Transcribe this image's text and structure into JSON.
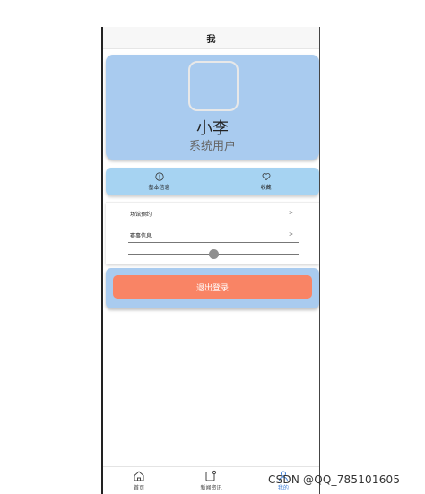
{
  "header": {
    "title": "我"
  },
  "profile": {
    "name": "小李",
    "role": "系统用户"
  },
  "shortcuts": [
    {
      "label": "基本信息",
      "icon": "info-icon"
    },
    {
      "label": "收藏",
      "icon": "heart-icon"
    }
  ],
  "list": [
    {
      "label": "场馆预约",
      "arrow": ">"
    },
    {
      "label": "赛事信息",
      "arrow": ">"
    }
  ],
  "slider": {
    "value": 0.5
  },
  "logout": {
    "label": "退出登录"
  },
  "tabbar": [
    {
      "label": "首页",
      "icon": "home-icon",
      "active": false
    },
    {
      "label": "新闻资讯",
      "icon": "news-icon",
      "active": false
    },
    {
      "label": "我的",
      "icon": "user-icon",
      "active": true
    }
  ],
  "watermark": "CSDN @QQ_785101605",
  "colors": {
    "card": "#a9cbef",
    "shortcut_bar": "#a6d3f2",
    "logout_button": "#f98465",
    "active_tab": "#3a7bd5"
  }
}
